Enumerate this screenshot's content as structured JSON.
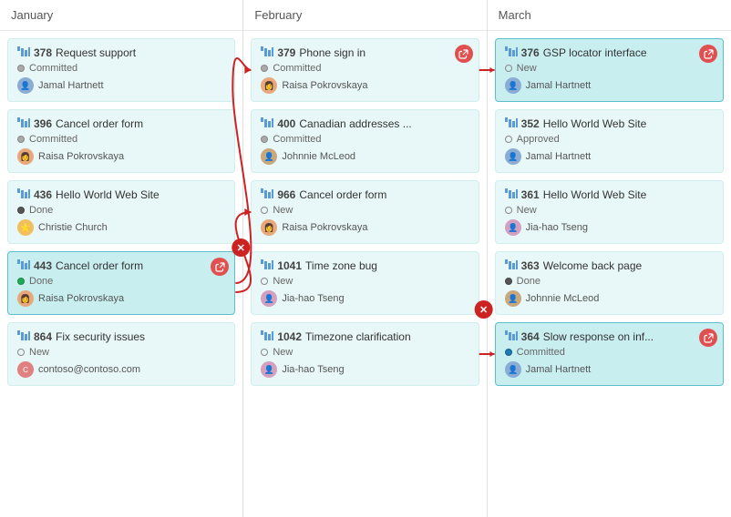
{
  "columns": [
    {
      "id": "january",
      "label": "January",
      "cards": [
        {
          "id": "378",
          "title": "Request support",
          "status": "Committed",
          "statusType": "committed",
          "user": "Jamal Hartnett",
          "userType": "jamal",
          "highlighted": false,
          "hasLink": false
        },
        {
          "id": "396",
          "title": "Cancel order form",
          "status": "Committed",
          "statusType": "committed",
          "user": "Raisa Pokrovskaya",
          "userType": "raisa",
          "highlighted": false,
          "hasLink": false
        },
        {
          "id": "436",
          "title": "Hello World Web Site",
          "status": "Done",
          "statusType": "done",
          "user": "Christie Church",
          "userType": "christie",
          "highlighted": false,
          "hasLink": false
        },
        {
          "id": "443",
          "title": "Cancel order form",
          "status": "Done",
          "statusType": "done-green",
          "user": "Raisa Pokrovskaya",
          "userType": "raisa",
          "highlighted": true,
          "hasLink": true
        },
        {
          "id": "864",
          "title": "Fix security issues",
          "status": "New",
          "statusType": "new",
          "user": "contoso@contoso.com",
          "userType": "contoso",
          "highlighted": false,
          "hasLink": false
        }
      ]
    },
    {
      "id": "february",
      "label": "February",
      "cards": [
        {
          "id": "379",
          "title": "Phone sign in",
          "status": "Committed",
          "statusType": "committed",
          "user": "Raisa Pokrovskaya",
          "userType": "raisa",
          "highlighted": false,
          "hasLink": true
        },
        {
          "id": "400",
          "title": "Canadian addresses ...",
          "status": "Committed",
          "statusType": "committed",
          "user": "Johnnie McLeod",
          "userType": "johnnie",
          "highlighted": false,
          "hasLink": false
        },
        {
          "id": "966",
          "title": "Cancel order form",
          "status": "New",
          "statusType": "new",
          "user": "Raisa Pokrovskaya",
          "userType": "raisa",
          "highlighted": false,
          "hasLink": false
        },
        {
          "id": "1041",
          "title": "Time zone bug",
          "status": "New",
          "statusType": "new",
          "user": "Jia-hao Tseng",
          "userType": "jia-hao",
          "highlighted": false,
          "hasLink": false
        },
        {
          "id": "1042",
          "title": "Timezone clarification",
          "status": "New",
          "statusType": "new",
          "user": "Jia-hao Tseng",
          "userType": "jia-hao",
          "highlighted": false,
          "hasLink": false
        }
      ]
    },
    {
      "id": "march",
      "label": "March",
      "cards": [
        {
          "id": "376",
          "title": "GSP locator interface",
          "status": "New",
          "statusType": "new",
          "user": "Jamal Hartnett",
          "userType": "jamal",
          "highlighted": true,
          "hasLink": true
        },
        {
          "id": "352",
          "title": "Hello World Web Site",
          "status": "Approved",
          "statusType": "approved",
          "user": "Jamal Hartnett",
          "userType": "jamal",
          "highlighted": false,
          "hasLink": false
        },
        {
          "id": "361",
          "title": "Hello World Web Site",
          "status": "New",
          "statusType": "new",
          "user": "Jia-hao Tseng",
          "userType": "jia-hao",
          "highlighted": false,
          "hasLink": false
        },
        {
          "id": "363",
          "title": "Welcome back page",
          "status": "Done",
          "statusType": "done",
          "user": "Johnnie McLeod",
          "userType": "johnnie",
          "highlighted": false,
          "hasLink": false
        },
        {
          "id": "364",
          "title": "Slow response on inf...",
          "status": "Committed",
          "statusType": "committed-blue",
          "user": "Jamal Hartnett",
          "userType": "jamal",
          "highlighted": true,
          "hasLink": true
        }
      ]
    }
  ],
  "icons": {
    "bars": "bars-icon",
    "link": "🔗",
    "close": "✕"
  }
}
